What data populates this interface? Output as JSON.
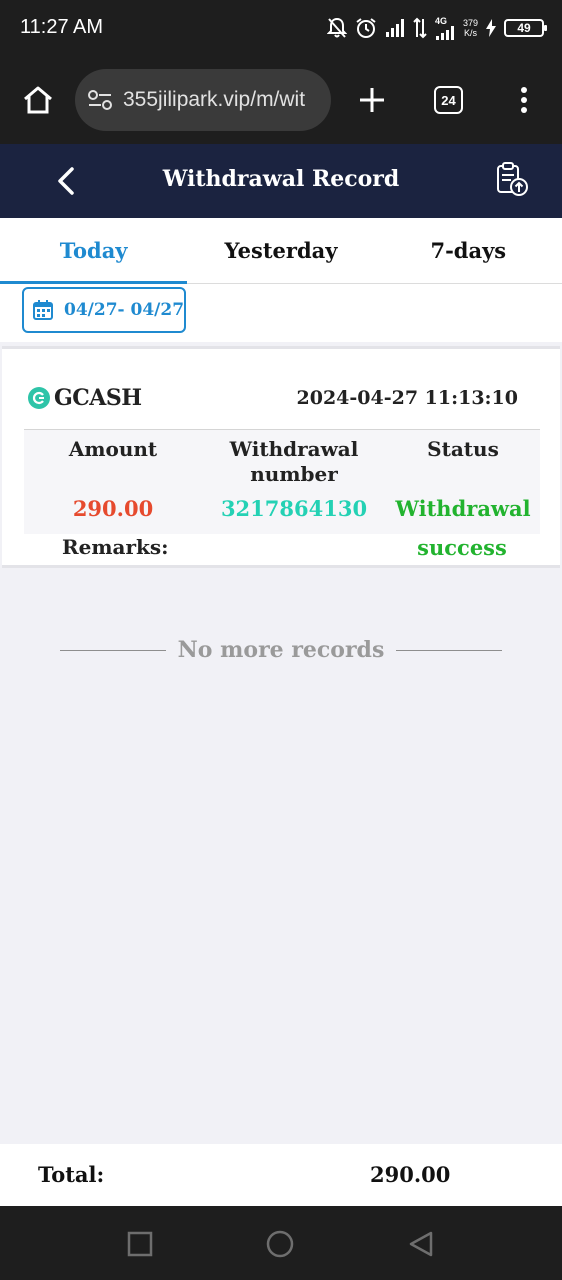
{
  "status_bar": {
    "time": "11:27 AM",
    "network": "4G",
    "speed_value": "379",
    "speed_unit": "K/s",
    "battery": "49",
    "icons": [
      "bell-off-icon",
      "alarm-icon",
      "signal-icon",
      "data-arrows-icon",
      "signal-icon",
      "charging-icon",
      "battery-icon"
    ]
  },
  "browser": {
    "url": "355jilipark.vip/m/wit",
    "tab_count": "24",
    "icons": [
      "home-icon",
      "site-settings-icon",
      "plus-icon",
      "tabs-icon",
      "more-vert-icon"
    ]
  },
  "header": {
    "title": "Withdrawal Record",
    "icons": [
      "back-icon",
      "record-upload-icon"
    ]
  },
  "tabs": [
    {
      "label": "Today",
      "active": true
    },
    {
      "label": "Yesterday",
      "active": false
    },
    {
      "label": "7-days",
      "active": false
    }
  ],
  "date_filter": {
    "range": "04/27- 04/27",
    "icon": "calendar-icon"
  },
  "record": {
    "provider": "GCASH",
    "provider_icon": "gcash-icon",
    "datetime": "2024-04-27 11:13:10",
    "amount_header": "Amount",
    "number_header_line1": "Withdrawal",
    "number_header_line2": "number",
    "status_header": "Status",
    "amount": "290.00",
    "withdrawal_number": "3217864130",
    "status_line1": "Withdrawal",
    "status_line2": "success",
    "remarks_label": "Remarks:",
    "colors": {
      "amount": "#e64a2e",
      "number": "#24d1b4",
      "status": "#22b32f"
    }
  },
  "no_more": "No more records",
  "total": {
    "label": "Total:",
    "value": "290.00"
  },
  "nav": {
    "icons": [
      "recents-icon",
      "home-circle-icon",
      "back-triangle-icon"
    ]
  },
  "colors": {
    "accent": "#1f8ad0",
    "header_bg": "#1b2340",
    "page_bg": "#f1f1f6"
  }
}
